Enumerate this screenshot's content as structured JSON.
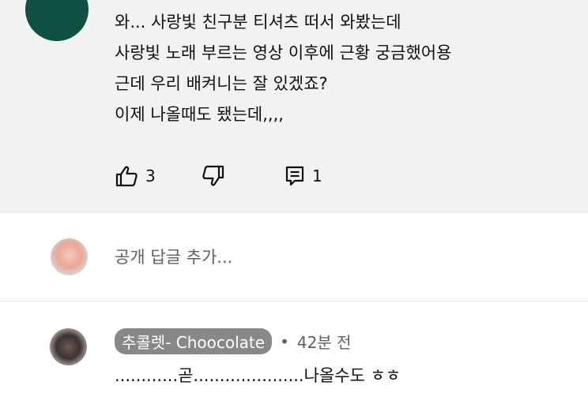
{
  "top_comment": {
    "lines": [
      "와... 사랑빛 친구분 티셔츠 떠서 와봤는데",
      "사랑빛 노래 부르는 영상 이후에 근황 궁금했어용",
      "근데 우리 배켜니는 잘 있겠죠?",
      "이제 나올때도 됐는데,,,,"
    ],
    "avatar_color": "#0e5142",
    "like_count": "3",
    "reply_count": "1",
    "icons": [
      "thumbs-up-icon",
      "thumbs-down-icon",
      "reply-icon"
    ]
  },
  "reply_box": {
    "placeholder": "공개 답글 추가..."
  },
  "reply": {
    "author": "추콜렛- Choocolate",
    "separator": "•",
    "time": "42분 전",
    "text": "............곧.....................나올수도 ㅎㅎ"
  }
}
